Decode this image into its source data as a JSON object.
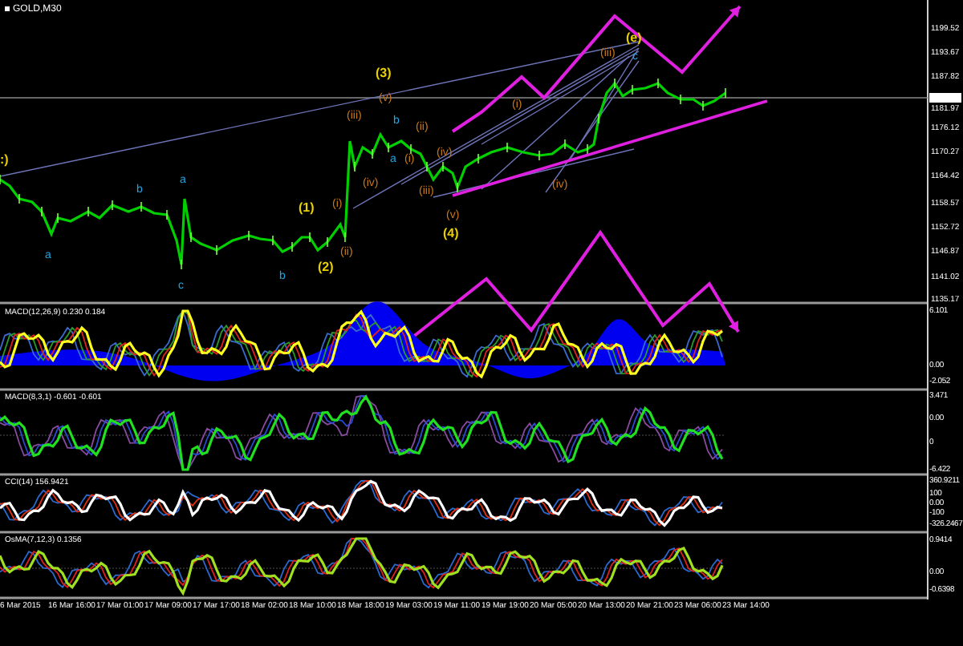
{
  "chart": {
    "title": "GOLD,M30",
    "price_axis": [
      "1199.52",
      "1193.67",
      "1187.82",
      "1181.97",
      "1176.12",
      "1170.27",
      "1164.42",
      "1158.57",
      "1152.72",
      "1146.87",
      "1141.02",
      "1135.17"
    ],
    "wave_labels": [
      {
        "text": ":)",
        "color": "#e8d000"
      },
      {
        "text": "a",
        "color": "#1ea8e8"
      },
      {
        "text": "b",
        "color": "#1ea8e8"
      },
      {
        "text": "a",
        "color": "#1ea8e8"
      },
      {
        "text": "c",
        "color": "#1ea8e8"
      },
      {
        "text": "b",
        "color": "#1ea8e8"
      },
      {
        "text": "(1)",
        "color": "#e8d000"
      },
      {
        "text": "(2)",
        "color": "#e8d000"
      },
      {
        "text": "(i)",
        "color": "#c87818"
      },
      {
        "text": "(ii)",
        "color": "#c87818"
      },
      {
        "text": "(iii)",
        "color": "#c87818"
      },
      {
        "text": "(iv)",
        "color": "#c87818"
      },
      {
        "text": "(3)",
        "color": "#e8d000"
      },
      {
        "text": "(v)",
        "color": "#c87818"
      },
      {
        "text": "b",
        "color": "#1ea8e8"
      },
      {
        "text": "a",
        "color": "#1ea8e8"
      },
      {
        "text": "(i)",
        "color": "#c87818"
      },
      {
        "text": "(ii)",
        "color": "#c87818"
      },
      {
        "text": "(iii)",
        "color": "#c87818"
      },
      {
        "text": "(iv)",
        "color": "#c87818"
      },
      {
        "text": "(v)",
        "color": "#c87818"
      },
      {
        "text": "(4)",
        "color": "#e8d000"
      },
      {
        "text": "(i)",
        "color": "#c87818"
      },
      {
        "text": "(iv)",
        "color": "#c87818"
      },
      {
        "text": "(iii)",
        "color": "#c87818"
      },
      {
        "text": "(e)",
        "color": "#e8d000"
      },
      {
        "text": "c",
        "color": "#1ea8e8"
      }
    ],
    "indicators": [
      {
        "label": "MACD(12,26,9) 0.230 0.184",
        "axis": [
          "6.101",
          "0.00",
          "-2.052"
        ]
      },
      {
        "label": "MACD(8,3,1) -0.601 -0.601",
        "axis": [
          "3.471",
          "0.00",
          "0",
          "-6.422"
        ]
      },
      {
        "label": "CCI(14) 156.9421",
        "axis": [
          "360.9211",
          "100",
          "0.00",
          "-100",
          "-326.2467"
        ]
      },
      {
        "label": "OsMA(7,12,3) 0.1356",
        "axis": [
          "0.9414",
          "0.00",
          "-0.6398"
        ]
      }
    ],
    "time_axis": [
      "6 Mar 2015",
      "16 Mar 16:00",
      "17 Mar 01:00",
      "17 Mar 09:00",
      "17 Mar 17:00",
      "18 Mar 02:00",
      "18 Mar 10:00",
      "18 Mar 18:00",
      "19 Mar 03:00",
      "19 Mar 11:00",
      "19 Mar 19:00",
      "20 Mar 05:00",
      "20 Mar 13:00",
      "20 Mar 21:00",
      "23 Mar 06:00",
      "23 Mar 14:00"
    ]
  }
}
